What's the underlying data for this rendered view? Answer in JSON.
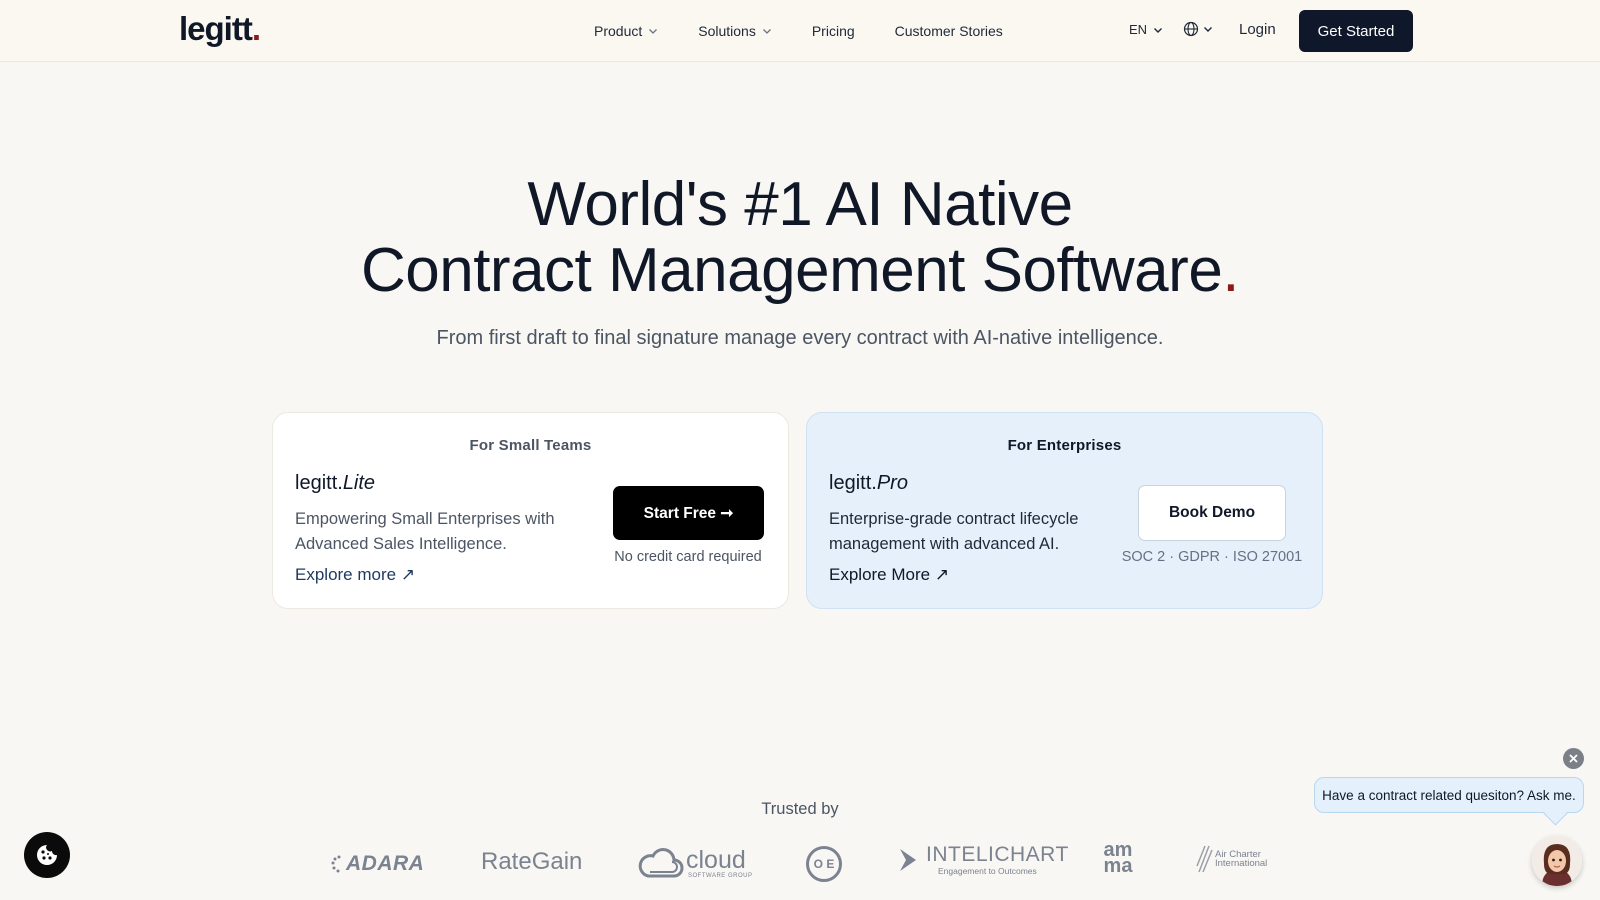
{
  "nav": {
    "logo_text": "legitt",
    "logo_dot": ".",
    "links": [
      {
        "label": "Product",
        "has_dropdown": true
      },
      {
        "label": "Solutions",
        "has_dropdown": true
      },
      {
        "label": "Pricing",
        "has_dropdown": false
      },
      {
        "label": "Customer Stories",
        "has_dropdown": false
      }
    ],
    "language": "EN",
    "globe_icon": "globe-icon",
    "login_label": "Login",
    "cta_label": "Get Started"
  },
  "hero": {
    "title_line1": "World's #1 AI Native",
    "title_line2": "Contract Management Software",
    "title_accent": ".",
    "subtitle": "From first draft to final signature manage every contract with AI-native intelligence."
  },
  "cards": {
    "lite": {
      "tag": "For Small Teams",
      "brand": "legitt.",
      "plan": "Lite",
      "description": "Empowering Small Enterprises with Advanced Sales Intelligence.",
      "explore_label": "Explore more ↗",
      "button_label": "Start Free ➞",
      "note": "No credit card required"
    },
    "pro": {
      "tag": "For Enterprises",
      "brand": "legitt.",
      "plan": "Pro",
      "description": "Enterprise-grade contract lifecycle management with advanced AI.",
      "explore_label": "Explore More ↗",
      "button_label": "Book Demo",
      "note": "SOC 2 · GDPR · ISO 27001"
    }
  },
  "trusted": {
    "heading": "Trusted by",
    "clients": [
      {
        "name": "ADARA"
      },
      {
        "name": "RateGain"
      },
      {
        "name": "cloud",
        "tag": "SOFTWARE GROUP"
      },
      {
        "name": "O E"
      },
      {
        "name": "INTELICHART",
        "tag": "Engagement to Outcomes"
      },
      {
        "name": "am ma"
      },
      {
        "name": "Air Charter International"
      }
    ]
  },
  "chat": {
    "prompt": "Have a contract related quesiton? Ask me."
  },
  "colors": {
    "accent": "#8b1a1a",
    "dark": "#0f172a",
    "pro_card": "#e5f0fb"
  }
}
